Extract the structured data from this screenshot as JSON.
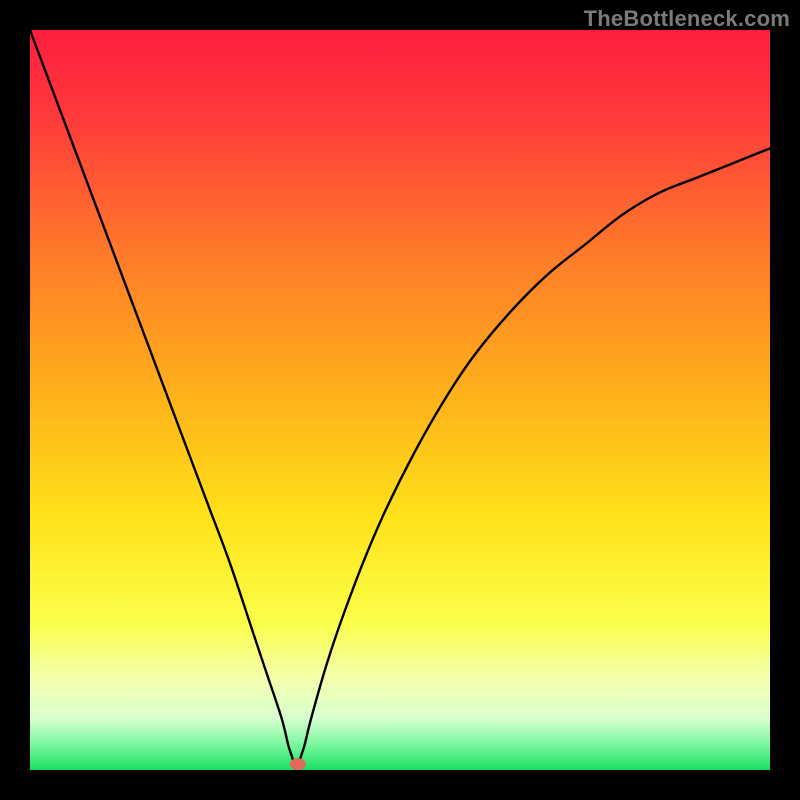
{
  "watermark": "TheBottleneck.com",
  "gradient_stops": [
    {
      "offset": 0,
      "color": "#ff1d3e"
    },
    {
      "offset": 0.12,
      "color": "#ff3b3b"
    },
    {
      "offset": 0.3,
      "color": "#ff7a2a"
    },
    {
      "offset": 0.5,
      "color": "#ffb31a"
    },
    {
      "offset": 0.66,
      "color": "#ffe21a"
    },
    {
      "offset": 0.8,
      "color": "#fbff4a"
    },
    {
      "offset": 0.88,
      "color": "#f3ffb0"
    },
    {
      "offset": 0.93,
      "color": "#d8ffd0"
    },
    {
      "offset": 0.965,
      "color": "#7cf7a0"
    },
    {
      "offset": 1.0,
      "color": "#18e060"
    }
  ],
  "marker": {
    "color": "#e06a5a",
    "cx_frac": 0.362,
    "cy_frac": 0.992,
    "rx": 8,
    "ry": 6
  },
  "chart_data": {
    "type": "line",
    "title": "",
    "xlabel": "",
    "ylabel": "",
    "xlim": [
      0,
      100
    ],
    "ylim": [
      0,
      100
    ],
    "grid": false,
    "legend": false,
    "description": "V-shaped bottleneck curve; left arm nearly linear from top-left to minimum, right arm rises concave toward upper-right. Minimum (optimal point) marked near x≈36.",
    "series": [
      {
        "name": "bottleneck-curve",
        "x": [
          0,
          3,
          6,
          9,
          12,
          15,
          18,
          21,
          24,
          27,
          30,
          32,
          34,
          35,
          36,
          37,
          38,
          40,
          42,
          45,
          48,
          52,
          56,
          60,
          65,
          70,
          75,
          80,
          85,
          90,
          95,
          100
        ],
        "y": [
          100,
          92,
          84,
          76,
          68,
          60,
          52,
          44,
          36,
          28,
          19,
          13,
          7,
          3,
          0,
          3,
          7,
          14,
          20,
          28,
          35,
          43,
          50,
          56,
          62,
          67,
          71,
          75,
          78,
          80,
          82,
          84
        ]
      }
    ],
    "optimal_point": {
      "x": 36,
      "y": 0
    }
  }
}
